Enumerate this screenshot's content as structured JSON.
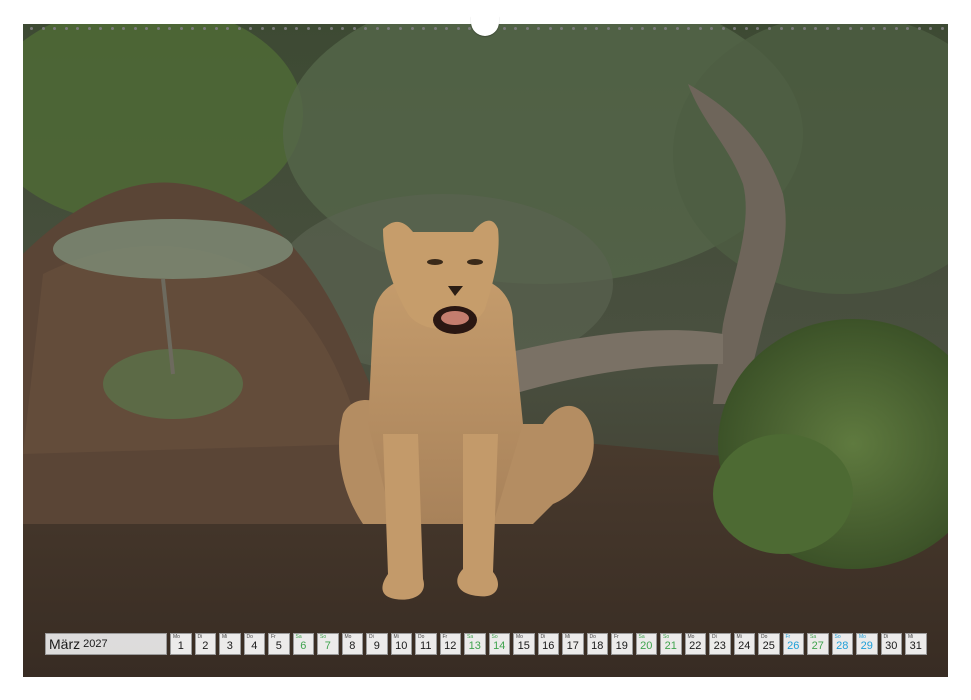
{
  "calendar": {
    "month": "März",
    "year": "2027",
    "days": [
      {
        "wd": "Mo",
        "d": "1",
        "type": "normal"
      },
      {
        "wd": "Di",
        "d": "2",
        "type": "normal"
      },
      {
        "wd": "Mi",
        "d": "3",
        "type": "normal"
      },
      {
        "wd": "Do",
        "d": "4",
        "type": "normal"
      },
      {
        "wd": "Fr",
        "d": "5",
        "type": "normal"
      },
      {
        "wd": "Sa",
        "d": "6",
        "type": "weekend"
      },
      {
        "wd": "So",
        "d": "7",
        "type": "weekend"
      },
      {
        "wd": "Mo",
        "d": "8",
        "type": "normal"
      },
      {
        "wd": "Di",
        "d": "9",
        "type": "normal"
      },
      {
        "wd": "Mi",
        "d": "10",
        "type": "normal"
      },
      {
        "wd": "Do",
        "d": "11",
        "type": "normal"
      },
      {
        "wd": "Fr",
        "d": "12",
        "type": "normal"
      },
      {
        "wd": "Sa",
        "d": "13",
        "type": "weekend"
      },
      {
        "wd": "So",
        "d": "14",
        "type": "weekend"
      },
      {
        "wd": "Mo",
        "d": "15",
        "type": "normal"
      },
      {
        "wd": "Di",
        "d": "16",
        "type": "normal"
      },
      {
        "wd": "Mi",
        "d": "17",
        "type": "normal"
      },
      {
        "wd": "Do",
        "d": "18",
        "type": "normal"
      },
      {
        "wd": "Fr",
        "d": "19",
        "type": "normal"
      },
      {
        "wd": "Sa",
        "d": "20",
        "type": "weekend"
      },
      {
        "wd": "So",
        "d": "21",
        "type": "weekend"
      },
      {
        "wd": "Mo",
        "d": "22",
        "type": "normal"
      },
      {
        "wd": "Di",
        "d": "23",
        "type": "normal"
      },
      {
        "wd": "Mi",
        "d": "24",
        "type": "normal"
      },
      {
        "wd": "Do",
        "d": "25",
        "type": "normal"
      },
      {
        "wd": "Fr",
        "d": "26",
        "type": "highlight"
      },
      {
        "wd": "Sa",
        "d": "27",
        "type": "weekend"
      },
      {
        "wd": "So",
        "d": "28",
        "type": "highlight"
      },
      {
        "wd": "Mo",
        "d": "29",
        "type": "highlight"
      },
      {
        "wd": "Di",
        "d": "30",
        "type": "normal"
      },
      {
        "wd": "Mi",
        "d": "31",
        "type": "normal"
      }
    ]
  },
  "colors": {
    "weekend": "#3fa34d",
    "holiday": "#1e9fd8",
    "text": "#1a1a1a"
  }
}
